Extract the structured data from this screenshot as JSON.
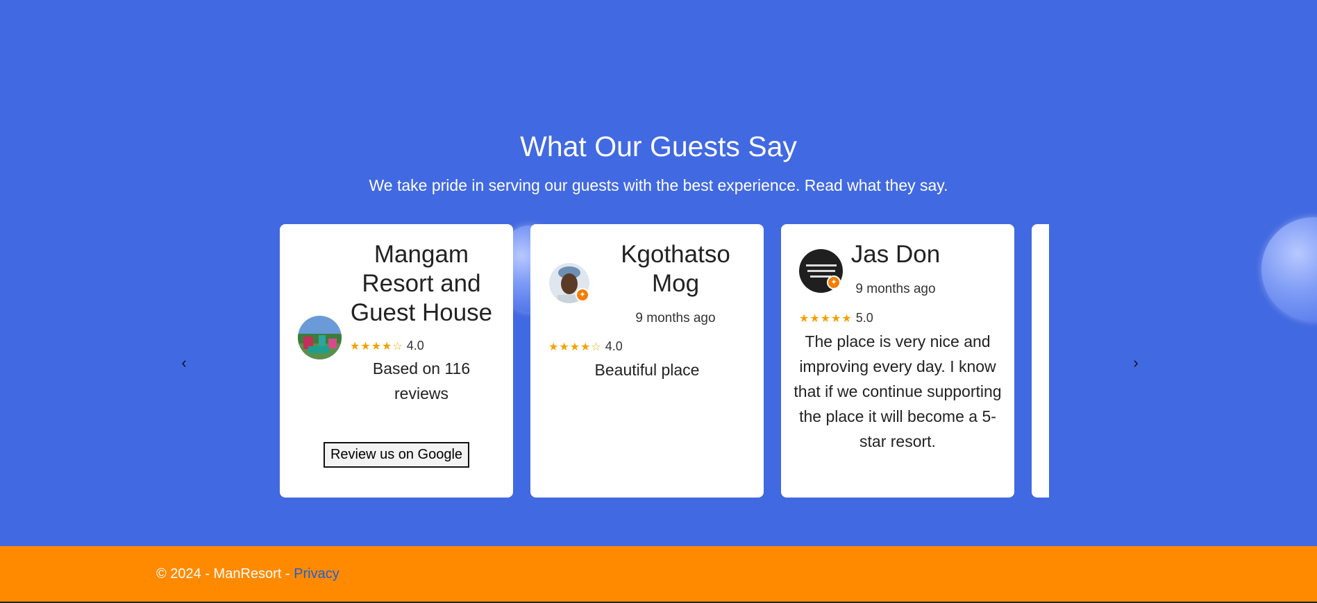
{
  "header": {
    "title": "What Our Guests Say",
    "subtitle": "We take pride in serving our guests with the best experience. Read what they say."
  },
  "carousel": {
    "prev_icon": "‹",
    "next_icon": "›",
    "summary": {
      "name": "Mangam Resort and Guest House",
      "stars": "★★★★☆",
      "rating": "4.0",
      "rating_fraction": 0.8,
      "based_on": "Based on 116 reviews",
      "button_label": "Review us on Google"
    },
    "reviews": [
      {
        "name": "Kgothatso Mog",
        "time": "9 months ago",
        "stars": "★★★★☆",
        "rating": "4.0",
        "text": "Beautiful place"
      },
      {
        "name": "Jas Don",
        "time": "9 months ago",
        "stars": "★★★★★",
        "rating": "5.0",
        "text": "The place is very nice and improving every day. I know that if we continue supporting the place it will become a 5-star resort."
      }
    ]
  },
  "footer": {
    "copyright": "© 2024 - ManResort - ",
    "privacy_link": "Privacy"
  },
  "colors": {
    "background": "#4169e1",
    "footer": "#ff8a00",
    "star": "#f4a100",
    "link": "#1f5fd6"
  }
}
